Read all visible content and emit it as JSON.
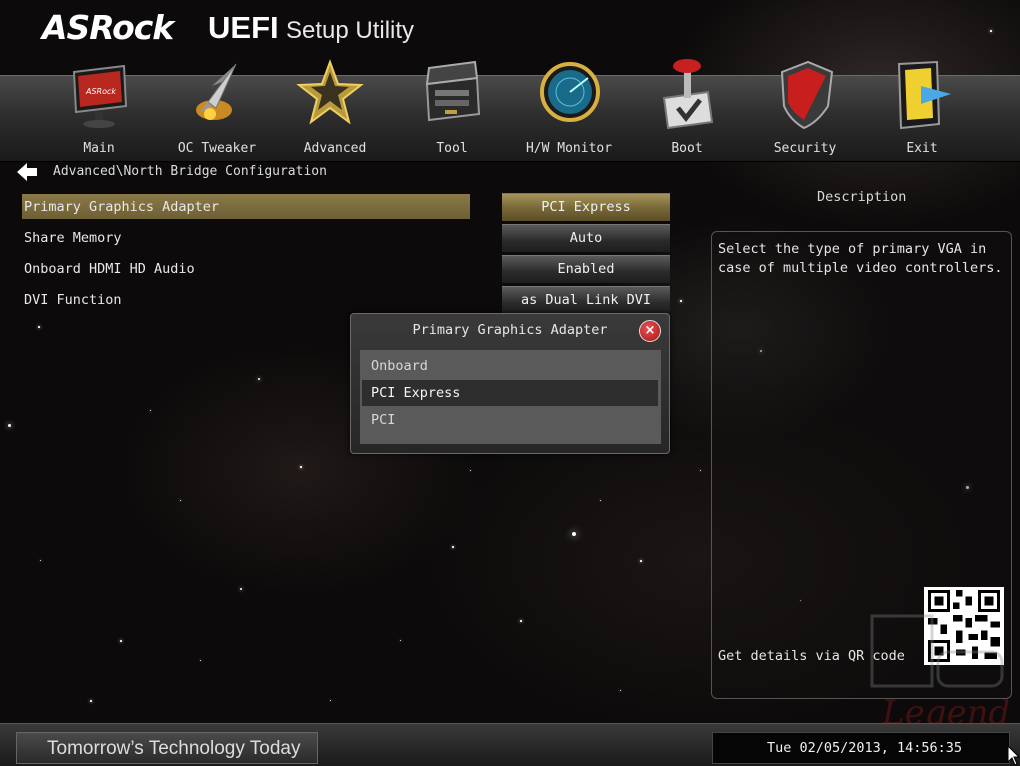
{
  "header": {
    "brand": "ASRock",
    "title_main": "UEFI",
    "title_sub": "Setup Utility"
  },
  "nav": [
    {
      "label": "Main",
      "icon": "monitor-icon"
    },
    {
      "label": "OC Tweaker",
      "icon": "rocket-icon"
    },
    {
      "label": "Advanced",
      "icon": "star-icon"
    },
    {
      "label": "Tool",
      "icon": "toolbox-icon"
    },
    {
      "label": "H/W Monitor",
      "icon": "radar-icon"
    },
    {
      "label": "Boot",
      "icon": "joystick-icon"
    },
    {
      "label": "Security",
      "icon": "shield-icon"
    },
    {
      "label": "Exit",
      "icon": "exit-door-icon"
    }
  ],
  "breadcrumb": "Advanced\\North Bridge Configuration",
  "settings": [
    {
      "label": "Primary Graphics Adapter",
      "value": "PCI Express"
    },
    {
      "label": "Share Memory",
      "value": "Auto"
    },
    {
      "label": "Onboard HDMI HD Audio",
      "value": "Enabled"
    },
    {
      "label": "DVI Function",
      "value": "as Dual Link DVI"
    }
  ],
  "description": {
    "title": "Description",
    "text": "Select the type of primary VGA in case of multiple video controllers.",
    "qr_label": "Get details via QR code"
  },
  "popup": {
    "title": "Primary Graphics Adapter",
    "options": [
      "Onboard",
      "PCI Express",
      "PCI"
    ],
    "selected": "PCI Express"
  },
  "footer": {
    "tagline": "Tomorrow’s Technology Today",
    "datetime": "Tue 02/05/2013, 14:56:35"
  },
  "colors": {
    "accent_gold": "#8a7a48",
    "close_red": "#c42020"
  }
}
